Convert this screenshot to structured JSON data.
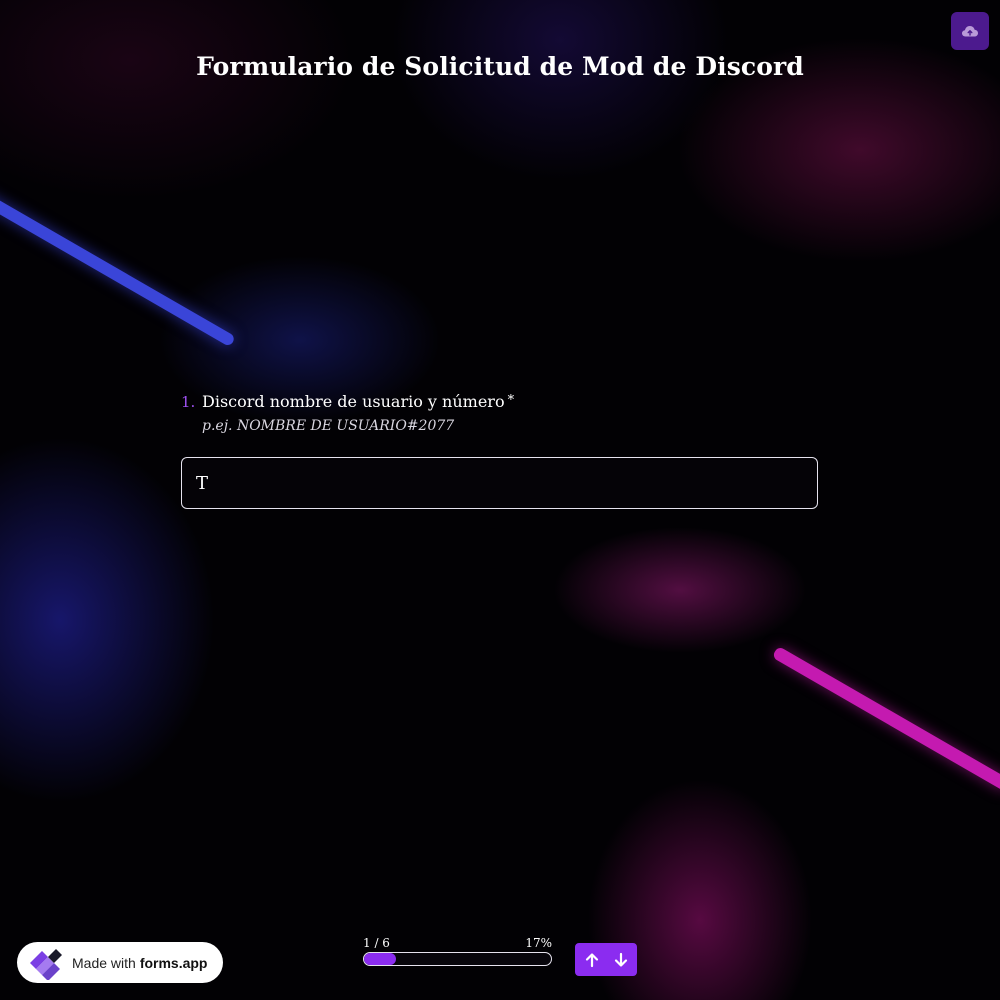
{
  "form": {
    "title": "Formulario de Solicitud de Mod de Discord"
  },
  "toolbar": {
    "save_icon": "cloud-upload-icon"
  },
  "question": {
    "number": "1.",
    "label": "Discord nombre de usuario y número",
    "required_mark": "*",
    "hint": "p.ej. NOMBRE DE USUARIO#2077",
    "input_value": "T"
  },
  "progress": {
    "step": "1 / 6",
    "percent_label": "17%",
    "percent": 17
  },
  "badge": {
    "made_with": "Made with",
    "brand": "forms.app"
  },
  "nav": {
    "up_icon": "arrow-up-icon",
    "down_icon": "arrow-down-icon"
  },
  "colors": {
    "accent": "#8b2cf0",
    "save_button": "#4c1a8e",
    "streak_blue": "#3a45d8",
    "streak_pink": "#c41ab0",
    "background": "#020104"
  }
}
